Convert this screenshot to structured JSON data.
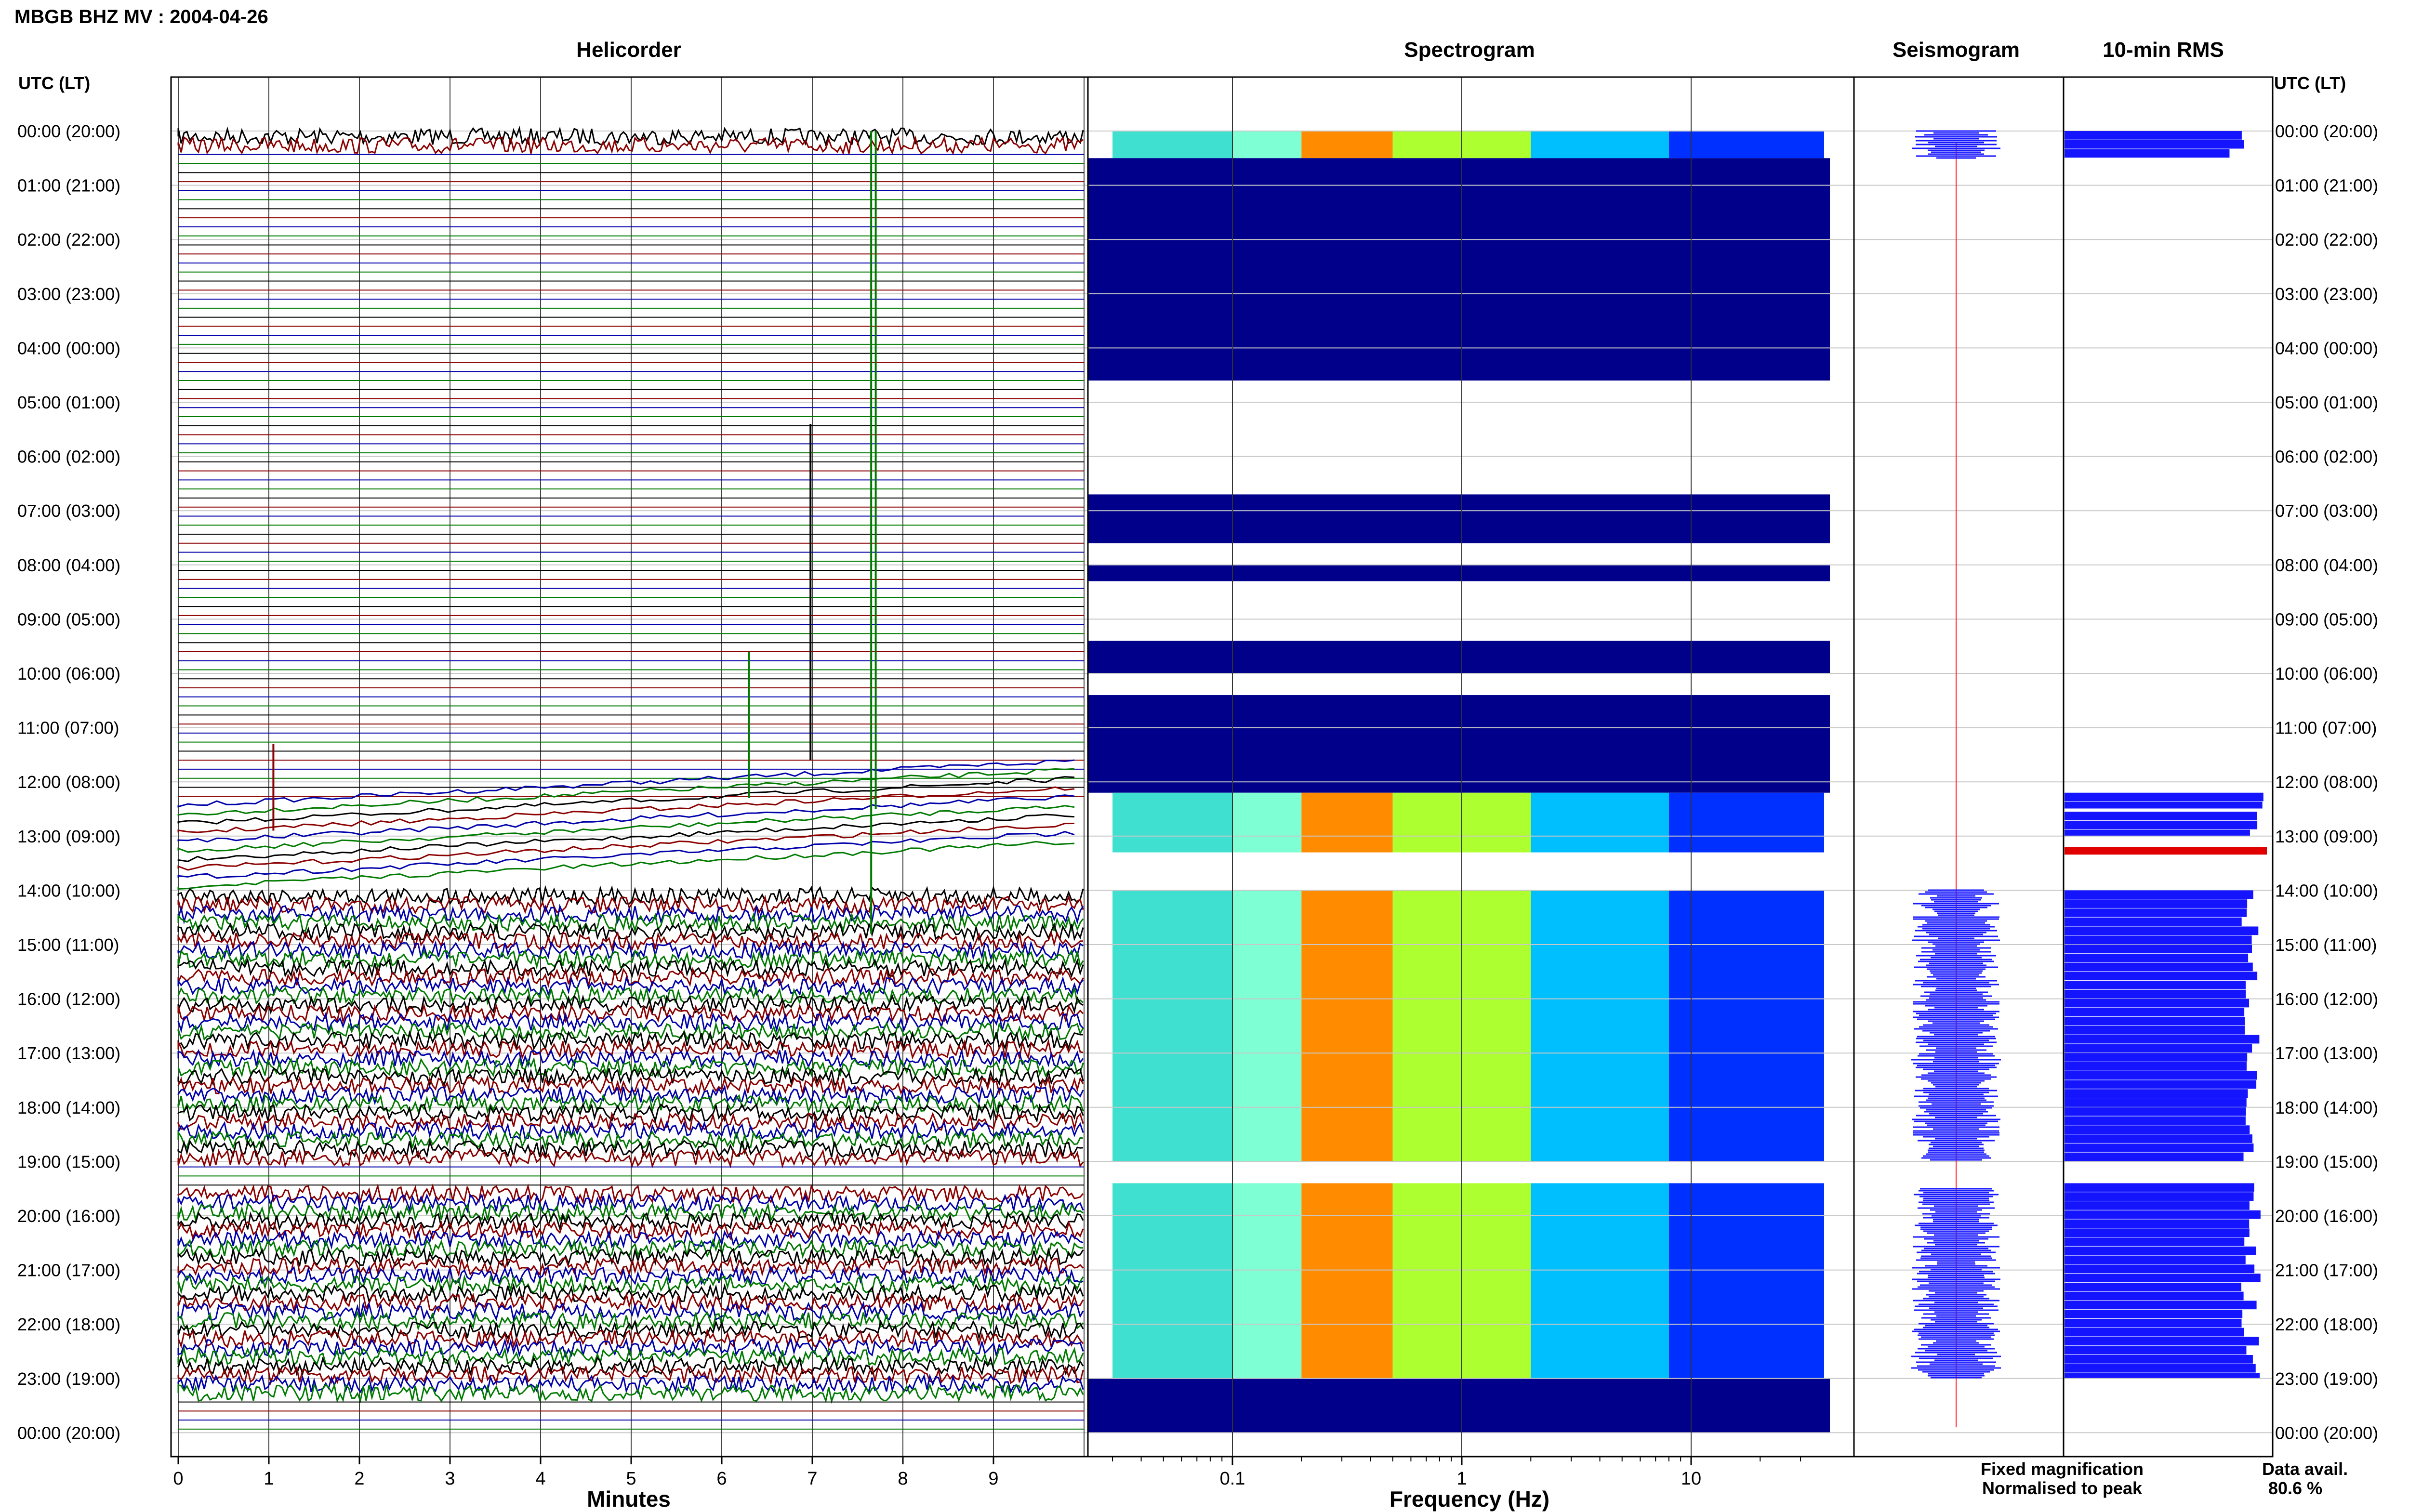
{
  "header": {
    "station_title": "MBGB BHZ MV : 2004-04-26",
    "utc_lt_left": "UTC (LT)",
    "utc_lt_right": "UTC (LT)"
  },
  "panels": {
    "helicorder": "Helicorder",
    "spectrogram": "Spectrogram",
    "seismogram": "Seismogram",
    "rms": "10-min RMS"
  },
  "axes": {
    "minutes_label": "Minutes",
    "frequency_label": "Frequency (Hz)",
    "minute_ticks": [
      "0",
      "1",
      "2",
      "3",
      "4",
      "5",
      "6",
      "7",
      "8",
      "9"
    ],
    "freq_ticks": [
      "0.1",
      "1",
      "10"
    ],
    "hour_labels": [
      "00:00 (20:00)",
      "01:00 (21:00)",
      "02:00 (22:00)",
      "03:00 (23:00)",
      "04:00 (00:00)",
      "05:00 (01:00)",
      "06:00 (02:00)",
      "07:00 (03:00)",
      "08:00 (04:00)",
      "09:00 (05:00)",
      "10:00 (06:00)",
      "11:00 (07:00)",
      "12:00 (08:00)",
      "13:00 (09:00)",
      "14:00 (10:00)",
      "15:00 (11:00)",
      "16:00 (12:00)",
      "17:00 (13:00)",
      "18:00 (14:00)",
      "19:00 (15:00)",
      "20:00 (16:00)",
      "21:00 (17:00)",
      "22:00 (18:00)",
      "23:00 (19:00)",
      "00:00 (20:00)"
    ]
  },
  "legend": {
    "fixed": "Fixed magnification",
    "normalised": "Normalised to peak",
    "fixed_color": "#1a1aff",
    "normalised_color": "#ff1a1a"
  },
  "availability": {
    "label": "Data avail.",
    "value": "80.6 %"
  },
  "colors": {
    "trace_cycle": [
      "#000000",
      "#8b0000",
      "#0000aa",
      "#007a00"
    ],
    "spectrogram_low": "#00008b",
    "spectrogram_mid": "#40e0d0",
    "spectrogram_high": "#ff8c00",
    "rms_fill": "#1414ff",
    "rms_alert": "#e00000"
  },
  "chart_data": [
    {
      "type": "line",
      "title": "Helicorder",
      "xlabel": "Minutes",
      "xlim": [
        0,
        10
      ],
      "ylabel": "UTC (LT)",
      "rows_per_hour": 6,
      "active_hour_ranges": [
        [
          0,
          0.3
        ],
        [
          14,
          19
        ],
        [
          19.5,
          23.3
        ]
      ],
      "sparse_hour_ranges": [
        [
          12.3,
          14
        ]
      ]
    },
    {
      "type": "heatmap",
      "title": "Spectrogram",
      "xlabel": "Frequency (Hz)",
      "xscale": "log",
      "xlim": [
        0.03,
        40
      ],
      "data_hour_ranges": [
        [
          0,
          0.5
        ],
        [
          0.5,
          4.6
        ],
        [
          6.7,
          7.6
        ],
        [
          8,
          8.3
        ],
        [
          9.4,
          10
        ],
        [
          10.4,
          12.2
        ],
        [
          12.2,
          13.3
        ],
        [
          14,
          19
        ],
        [
          19.4,
          23
        ],
        [
          23,
          24
        ]
      ],
      "energetic_hour_ranges": [
        [
          0,
          0.5
        ],
        [
          12.2,
          13.3
        ],
        [
          14,
          19
        ],
        [
          19.4,
          23
        ]
      ],
      "peak_frequency_hz": [
        0.2,
        0.5
      ]
    },
    {
      "type": "line",
      "title": "Seismogram",
      "fixed_magnification_hour_ranges": [
        [
          0,
          0.5
        ],
        [
          14,
          19
        ],
        [
          19.5,
          23
        ]
      ]
    },
    {
      "type": "bar",
      "title": "10-min RMS",
      "orientation": "horizontal",
      "segments": [
        {
          "start_hour": 0,
          "end_hour": 0.5,
          "level": 0.9
        },
        {
          "start_hour": 12.2,
          "end_hour": 12.5,
          "level": 1.0
        },
        {
          "start_hour": 12.55,
          "end_hour": 13.0,
          "level": 1.0
        },
        {
          "start_hour": 13.2,
          "end_hour": 13.35,
          "level": 1.0,
          "alert": true
        },
        {
          "start_hour": 14,
          "end_hour": 19,
          "level": 0.97
        },
        {
          "start_hour": 19.4,
          "end_hour": 23,
          "level": 0.97
        }
      ]
    }
  ]
}
